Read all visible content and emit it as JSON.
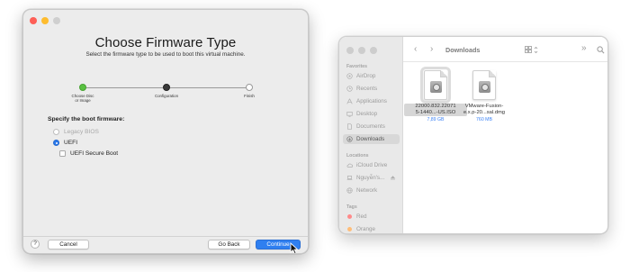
{
  "wizard": {
    "title": "Choose Firmware Type",
    "subtitle": "Select the firmware type to be used to boot this virtual machine.",
    "steps": [
      {
        "label": "Choose Disc\nor Image",
        "state": "done"
      },
      {
        "label": "Configuration",
        "state": "current"
      },
      {
        "label": "Finish",
        "state": "todo"
      }
    ],
    "section_label": "Specify the boot firmware:",
    "options": {
      "legacy_bios": "Legacy BIOS",
      "uefi": "UEFI",
      "uefi_secure_boot": "UEFI Secure Boot"
    },
    "selected_option": "UEFI",
    "secure_boot_checked": false,
    "buttons": {
      "help": "?",
      "cancel": "Cancel",
      "go_back": "Go Back",
      "continue": "Continue"
    }
  },
  "finder": {
    "title": "Downloads",
    "sidebar": {
      "favorites_label": "Favorites",
      "favorites": [
        {
          "label": "AirDrop",
          "icon": "airdrop-icon"
        },
        {
          "label": "Recents",
          "icon": "clock-icon"
        },
        {
          "label": "Applications",
          "icon": "applications-icon"
        },
        {
          "label": "Desktop",
          "icon": "desktop-icon"
        },
        {
          "label": "Documents",
          "icon": "document-icon"
        },
        {
          "label": "Downloads",
          "icon": "download-icon"
        }
      ],
      "locations_label": "Locations",
      "locations": [
        {
          "label": "iCloud Drive",
          "icon": "cloud-icon"
        },
        {
          "label": "Nguyễn's...",
          "icon": "laptop-icon"
        },
        {
          "label": "Network",
          "icon": "globe-icon"
        }
      ],
      "tags_label": "Tags",
      "tags": [
        {
          "label": "Red",
          "color": "#ff6b6b"
        },
        {
          "label": "Orange",
          "color": "#ffa54a"
        }
      ]
    },
    "files": [
      {
        "name": "22000.832.220715-1440...-US.ISO",
        "name_line1": "22000.832.22071",
        "name_line2": "5-1440...-US.ISO",
        "size": "7,89 GB",
        "selected": true
      },
      {
        "name": "VMware-Fusion-e.x.p-20...sal.dmg",
        "name_line1": "VMware-Fusion-",
        "name_line2": "e.x.p-20...sal.dmg",
        "size": "760 MB",
        "selected": false
      }
    ]
  },
  "colors": {
    "accent": "#2f7ff0",
    "step_done": "#5ac142",
    "step_current": "#3a3a3a",
    "file_size_text": "#3b82f6"
  }
}
